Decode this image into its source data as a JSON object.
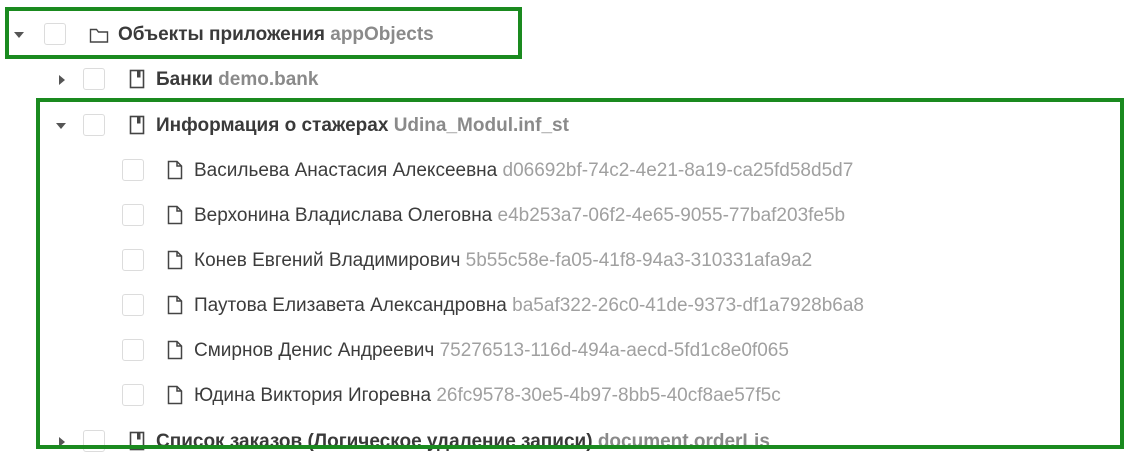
{
  "tree": {
    "root": {
      "name": "Объекты приложения",
      "code": "appObjects",
      "expanded": true,
      "icon": "folder-icon"
    },
    "groups": [
      {
        "name": "Банки",
        "code": "demo.bank",
        "expanded": false,
        "icon": "bookmark-icon"
      },
      {
        "name": "Информация о стажерах",
        "code": "Udina_Modul.inf_st",
        "expanded": true,
        "icon": "bookmark-icon",
        "items": [
          {
            "name": "Васильева Анастасия Алексеевна",
            "code": "d06692bf-74c2-4e21-8a19-ca25fd58d5d7"
          },
          {
            "name": "Верхонина Владислава Олеговна",
            "code": "e4b253a7-06f2-4e65-9055-77baf203fe5b"
          },
          {
            "name": "Конев Евгений Владимирович",
            "code": "5b55c58e-fa05-41f8-94a3-310331afa9a2"
          },
          {
            "name": "Паутова Елизавета Александровна",
            "code": "ba5af322-26c0-41de-9373-df1a7928b6a8"
          },
          {
            "name": "Смирнов Денис Андреевич",
            "code": "75276513-116d-494a-aecd-5fd1c8e0f065"
          },
          {
            "name": "Юдина Виктория Игоревна",
            "code": "26fc9578-30e5-4b97-8bb5-40cf8ae57f5c"
          }
        ]
      },
      {
        "name": "Список заказов (Логическое удаление записи)",
        "code": "document.orderLis",
        "expanded": false,
        "icon": "bookmark-icon"
      }
    ]
  },
  "colors": {
    "highlight": "#1a8a1f",
    "checkbox_border": "#dcdcdc",
    "name_text": "#3a3a3a",
    "code_text": "#a0a0a0"
  }
}
